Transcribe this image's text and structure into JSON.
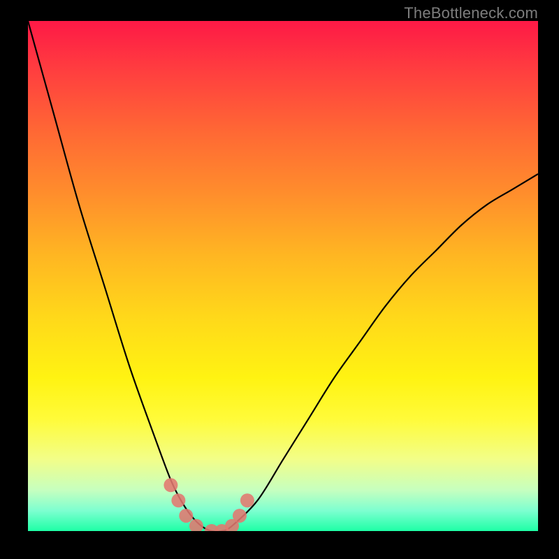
{
  "watermark": "TheBottleneck.com",
  "colors": {
    "background": "#000000",
    "curve": "#000000",
    "marker": "#e27770",
    "gradient_top": "#fe1946",
    "gradient_bottom": "#1effa6"
  },
  "chart_data": {
    "type": "line",
    "title": "",
    "xlabel": "",
    "ylabel": "",
    "xlim": [
      0,
      100
    ],
    "ylim": [
      0,
      100
    ],
    "series": [
      {
        "name": "curve",
        "x": [
          0,
          5,
          10,
          15,
          20,
          25,
          28,
          30,
          32,
          34,
          36,
          38,
          40,
          45,
          50,
          55,
          60,
          65,
          70,
          75,
          80,
          85,
          90,
          95,
          100
        ],
        "y": [
          100,
          82,
          64,
          48,
          32,
          18,
          10,
          6,
          3,
          1,
          0,
          0,
          1,
          6,
          14,
          22,
          30,
          37,
          44,
          50,
          55,
          60,
          64,
          67,
          70
        ]
      }
    ],
    "markers": {
      "name": "highlight-points",
      "x": [
        28,
        29.5,
        31,
        33,
        36,
        38,
        40,
        41.5,
        43
      ],
      "y": [
        9,
        6,
        3,
        1,
        0,
        0,
        1,
        3,
        6
      ]
    }
  }
}
